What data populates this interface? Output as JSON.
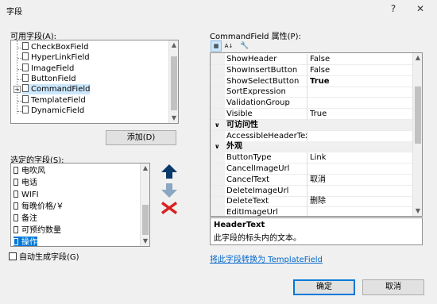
{
  "window": {
    "title": "字段",
    "help_label": "?",
    "close_label": "✕"
  },
  "available": {
    "label": "可用字段(A):",
    "items": [
      "CheckBoxField",
      "HyperLinkField",
      "ImageField",
      "ButtonField",
      "CommandField",
      "TemplateField",
      "DynamicField"
    ],
    "selected_index": 4,
    "add_button": "添加(D)"
  },
  "selected_fields": {
    "label": "选定的字段(S):",
    "items": [
      "电吹风",
      "电话",
      "WIFI",
      "每晚价格/￥",
      "备注",
      "可预约数量",
      "操作"
    ],
    "selected_index": 6
  },
  "auto_generate": {
    "label": "自动生成字段(G)",
    "checked": false
  },
  "properties": {
    "label": "CommandField 属性(P):",
    "rows": [
      {
        "name": "ShowHeader",
        "value": "False"
      },
      {
        "name": "ShowInsertButton",
        "value": "False"
      },
      {
        "name": "ShowSelectButton",
        "value": "True",
        "bold": true
      },
      {
        "name": "SortExpression",
        "value": ""
      },
      {
        "name": "ValidationGroup",
        "value": ""
      },
      {
        "name": "Visible",
        "value": "True"
      },
      {
        "category": "可访问性"
      },
      {
        "name": "AccessibleHeaderTex",
        "value": ""
      },
      {
        "category": "外观"
      },
      {
        "name": "ButtonType",
        "value": "Link"
      },
      {
        "name": "CancelImageUrl",
        "value": ""
      },
      {
        "name": "CancelText",
        "value": "取消"
      },
      {
        "name": "DeleteImageUrl",
        "value": ""
      },
      {
        "name": "DeleteText",
        "value": "删除"
      },
      {
        "name": "EditImageUrl",
        "value": ""
      }
    ],
    "description_title": "HeaderText",
    "description_text": "此字段的标头内的文本。"
  },
  "convert_link": "将此字段转换为 TemplateField",
  "ok_button": "确定",
  "cancel_button": "取消",
  "colors": {
    "accent": "#0078d7",
    "up_arrow": "#0a3a6a",
    "down_arrow": "#8aa6c0",
    "delete": "#d92020"
  }
}
